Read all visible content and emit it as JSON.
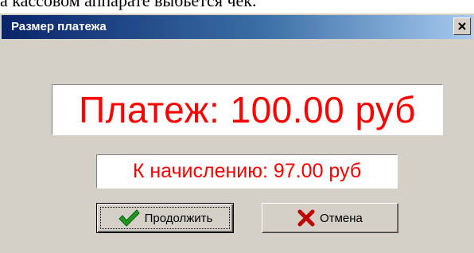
{
  "background_text": "а кассовом аппарате  выбьется  чек.",
  "dialog": {
    "title": "Размер платежа",
    "close_label": "×"
  },
  "payment": {
    "text": "Платеж: 100.00 руб"
  },
  "accrual": {
    "text": "К начислению: 97.00 руб"
  },
  "buttons": {
    "continue_label": "Продолжить",
    "cancel_label": "Отмена"
  },
  "colors": {
    "amount_text": "#ff0000",
    "dialog_face": "#d4d0c8",
    "titlebar_start": "#0a246a",
    "check_icon": "#1e9a1e",
    "cancel_icon": "#c00000"
  },
  "icons": {
    "continue": "checkmark-icon",
    "cancel": "x-icon",
    "close": "close-icon"
  }
}
